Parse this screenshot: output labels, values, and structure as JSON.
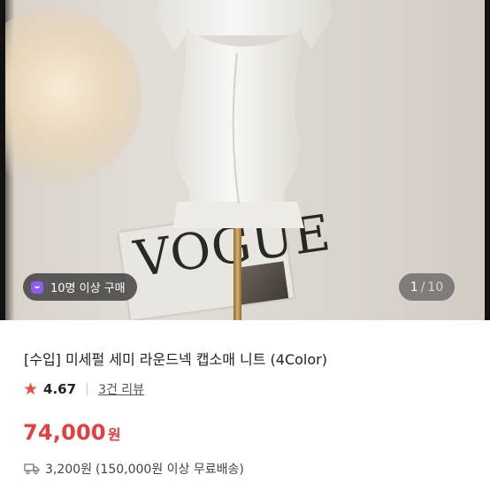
{
  "gallery": {
    "buyer_badge": "10명 이상 구매",
    "current_page": "1",
    "separator": "/",
    "total_pages": "10",
    "magazine_text": "VOGUE"
  },
  "product": {
    "title": "[수입] 미세펄 세미 라운드넥 캡소매 니트 (4Color)",
    "rating": "4.67",
    "review_link": "3건 리뷰",
    "price_value": "74,000",
    "price_unit": "원",
    "shipping_fee": "3,200원",
    "shipping_condition": "(150,000원 이상 무료배송)"
  },
  "colors": {
    "accent_red": "#e83d3d",
    "star_red": "#f04b3c",
    "badge_purple": "#8b5cf6"
  },
  "icons": {
    "badge_icon": "shopping-bag-icon",
    "rating_icon": "star-icon",
    "shipping_icon": "truck-icon"
  }
}
